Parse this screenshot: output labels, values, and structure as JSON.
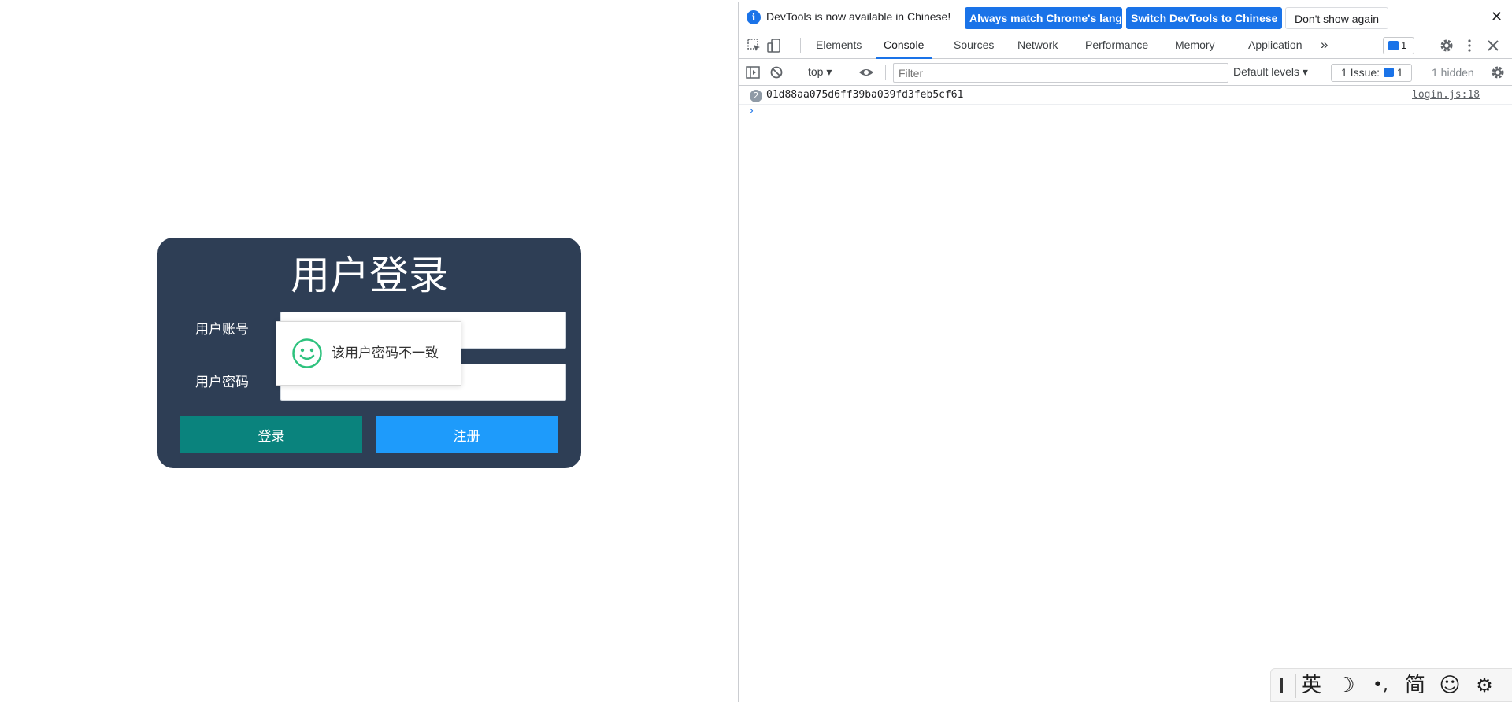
{
  "login": {
    "title": "用户登录",
    "account_label": "用户账号",
    "password_label": "用户密码",
    "account_value": "",
    "password_value": "",
    "login_button": "登录",
    "register_button": "注册",
    "toast_text": "该用户密码不一致",
    "toast_icon": "smile-icon",
    "colors": {
      "card_bg": "#2e3e55",
      "login_btn": "#0a837d",
      "register_btn": "#1e9bfb",
      "toast_icon": "#2ec27e"
    }
  },
  "devtools": {
    "infobar": {
      "text": "DevTools is now available in Chinese!",
      "match_button": "Always match Chrome's language",
      "switch_button": "Switch DevTools to Chinese",
      "dont_show_button": "Don't show again",
      "close": "✕"
    },
    "tabs": [
      {
        "label": "Elements",
        "active": false
      },
      {
        "label": "Console",
        "active": true
      },
      {
        "label": "Sources",
        "active": false
      },
      {
        "label": "Network",
        "active": false
      },
      {
        "label": "Performance",
        "active": false
      },
      {
        "label": "Memory",
        "active": false
      },
      {
        "label": "Application",
        "active": false
      }
    ],
    "more_tabs": "»",
    "messages_count": "1",
    "toolbar": {
      "context": "top ▾",
      "filter_placeholder": "Filter",
      "levels": "Default levels ▾",
      "issues": "1 Issue:",
      "issues_count": "1",
      "hidden": "1 hidden"
    },
    "console": {
      "repeat_count": "2",
      "message": "01d88aa075d6ff39ba039fd3feb5cf61",
      "source": "login.js:18",
      "prompt": "›"
    },
    "accent": "#1a73e8"
  },
  "ime": {
    "lang": "英",
    "moon": "☽",
    "punct": "•,",
    "simplified": "简",
    "emoji": "☺",
    "settings": "⚙"
  }
}
